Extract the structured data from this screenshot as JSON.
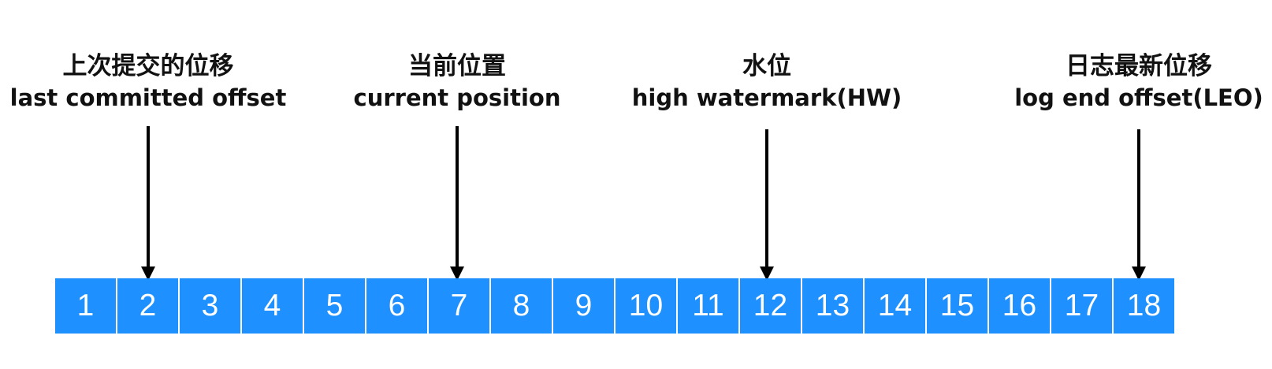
{
  "labels": [
    {
      "zh": "上次提交的位移",
      "en": "last committed offset",
      "cell": "2"
    },
    {
      "zh": "当前位置",
      "en": "current position",
      "cell": "7"
    },
    {
      "zh": "水位",
      "en": "high watermark(HW)",
      "cell": "12"
    },
    {
      "zh": "日志最新位移",
      "en": "log end offset(LEO)",
      "cell": "18"
    }
  ],
  "cells": [
    "1",
    "2",
    "3",
    "4",
    "5",
    "6",
    "7",
    "8",
    "9",
    "10",
    "11",
    "12",
    "13",
    "14",
    "15",
    "16",
    "17",
    "18"
  ],
  "colors": {
    "cell_fill": "#1E90FF",
    "cell_text": "#FFFFFF",
    "arrow": "#000000",
    "text": "#111111"
  }
}
